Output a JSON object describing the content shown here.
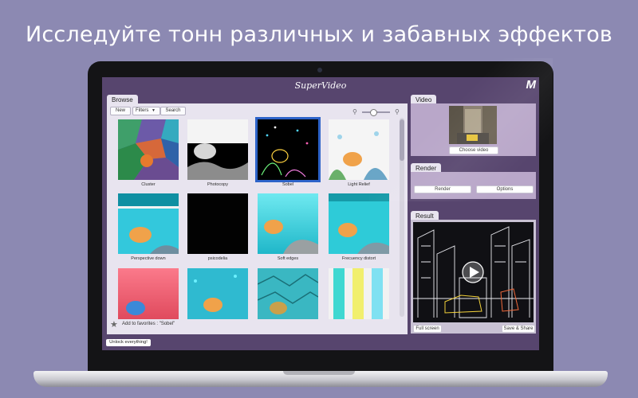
{
  "headline": "Исследуйте тонн различных и забавных эффектов",
  "app": {
    "title": "SuperVideo",
    "logo": "M"
  },
  "browse": {
    "tab": "Browse",
    "new_label": "New",
    "filters_label": "Filters",
    "search_label": "Search",
    "favorites_text": "Add to favorites : \"Sobel\"",
    "items": [
      {
        "label": "Cluster"
      },
      {
        "label": "Photocopy"
      },
      {
        "label": "Sobel"
      },
      {
        "label": "Light Relief"
      },
      {
        "label": "Perspective down"
      },
      {
        "label": "psicodelia"
      },
      {
        "label": "Soft edges"
      },
      {
        "label": "Frecuency distort"
      },
      {
        "label": ""
      },
      {
        "label": ""
      },
      {
        "label": ""
      },
      {
        "label": ""
      }
    ]
  },
  "unlock_label": "Unlock everything!",
  "video": {
    "tab": "Video",
    "choose_label": "Choose video"
  },
  "render": {
    "tab": "Render",
    "render_label": "Render",
    "options_label": "Options"
  },
  "result": {
    "tab": "Result",
    "fullscreen_label": "Full screen",
    "save_share_label": "Save & Share"
  },
  "colors": {
    "page_bg": "#8c89b2",
    "app_bg": "#57456e",
    "panel_bg": "#e8e4ef",
    "right_panel_bg": "#b9a7c9",
    "selection": "#2d63c9"
  }
}
